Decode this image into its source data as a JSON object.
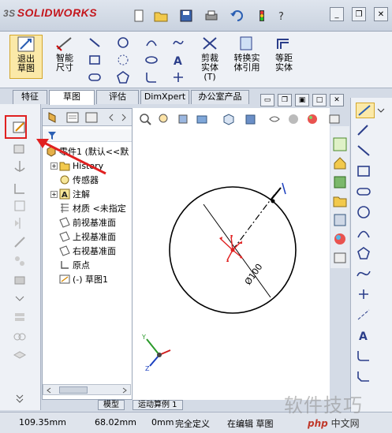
{
  "app": {
    "logo_prefix": "3S",
    "logo": "SOLIDWORKS"
  },
  "ribbon": {
    "exit_sketch": "退出草图",
    "smart_dim": "智能尺寸",
    "trim": "剪裁实体(T)",
    "convert": "转换实体引用",
    "offset": "等距实体"
  },
  "tabs": [
    "特征",
    "草图",
    "评估",
    "DimXpert",
    "办公室产品"
  ],
  "tree": {
    "part": "零件1 (默认<<默",
    "history": "History",
    "sensors": "传感器",
    "annotations": "注解",
    "material": "材质 <未指定",
    "front": "前视基准面",
    "top": "上视基准面",
    "right": "右视基准面",
    "origin": "原点",
    "sketch": "(-) 草图1"
  },
  "dimension": "Ø100",
  "bottom_tabs": [
    "模型",
    "运动算例 1"
  ],
  "status": {
    "x": "109.35mm",
    "y": "68.02mm",
    "z": "0mm",
    "state": "完全定义",
    "editing": "在编辑 草图"
  },
  "watermark": "软件技巧",
  "php_logo": "php",
  "php_site": "中文网",
  "colors": {
    "accent": "#e02020",
    "circle": "#000000",
    "centerline": "#000000",
    "point": "#e02020"
  }
}
